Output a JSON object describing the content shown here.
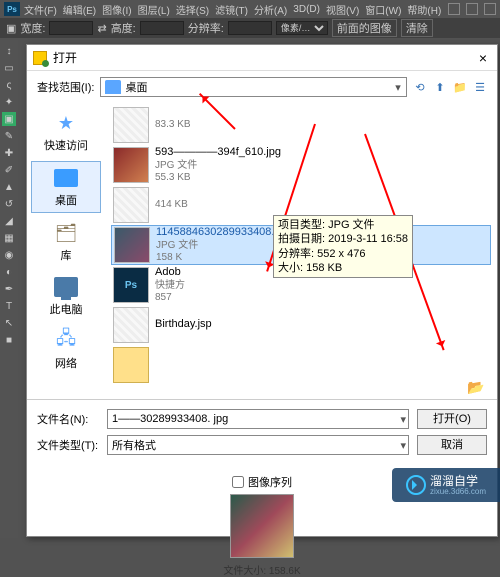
{
  "menu": {
    "items": [
      "文件(F)",
      "编辑(E)",
      "图像(I)",
      "图层(L)",
      "选择(S)",
      "滤镜(T)",
      "分析(A)",
      "3D(D)",
      "视图(V)",
      "窗口(W)",
      "帮助(H)"
    ]
  },
  "opt": {
    "w": "宽度:",
    "h": "高度:",
    "res": "分辨率:",
    "unit": "像素/…",
    "front": "前面的图像",
    "clear": "清除"
  },
  "dialog": {
    "title": "打开",
    "lookin_label": "查找范围(I):",
    "lookin_value": "桌面",
    "sidebar": [
      {
        "label": "快速访问"
      },
      {
        "label": "桌面"
      },
      {
        "label": "库"
      },
      {
        "label": "此电脑"
      },
      {
        "label": "网络"
      }
    ],
    "files": [
      {
        "name": "",
        "type": "",
        "size": "83.3 KB"
      },
      {
        "name": "593————394f_610.jpg",
        "type": "JPG 文件",
        "size": "55.3 KB"
      },
      {
        "name": "",
        "type": "",
        "size": "414 KB"
      },
      {
        "name": "11458846302899334​08.jpg",
        "type": "JPG 文件",
        "size": "158 K"
      },
      {
        "name": "Adob",
        "type": "快捷方",
        "size": "857"
      },
      {
        "name": "Birthday.jsp",
        "type": "",
        "size": ""
      },
      {
        "name": "",
        "type": "",
        "size": ""
      }
    ],
    "tooltip": {
      "l1": "项目类型: JPG 文件",
      "l2": "拍摄日期: 2019-3-11 16:58",
      "l3": "分辨率: 552 x 476",
      "l4": "大小: 158 KB"
    },
    "filename_label": "文件名(N):",
    "filename_value": "1——30289933408. jpg",
    "filetype_label": "文件类型(T):",
    "filetype_value": "所有格式",
    "open_btn": "打开(O)",
    "cancel_btn": "取消",
    "seq_label": "图像序列",
    "preview_size": "文件大小: 158.6K"
  },
  "watermark": {
    "title": "溜溜自学",
    "sub": "zixue.3d66.com"
  }
}
